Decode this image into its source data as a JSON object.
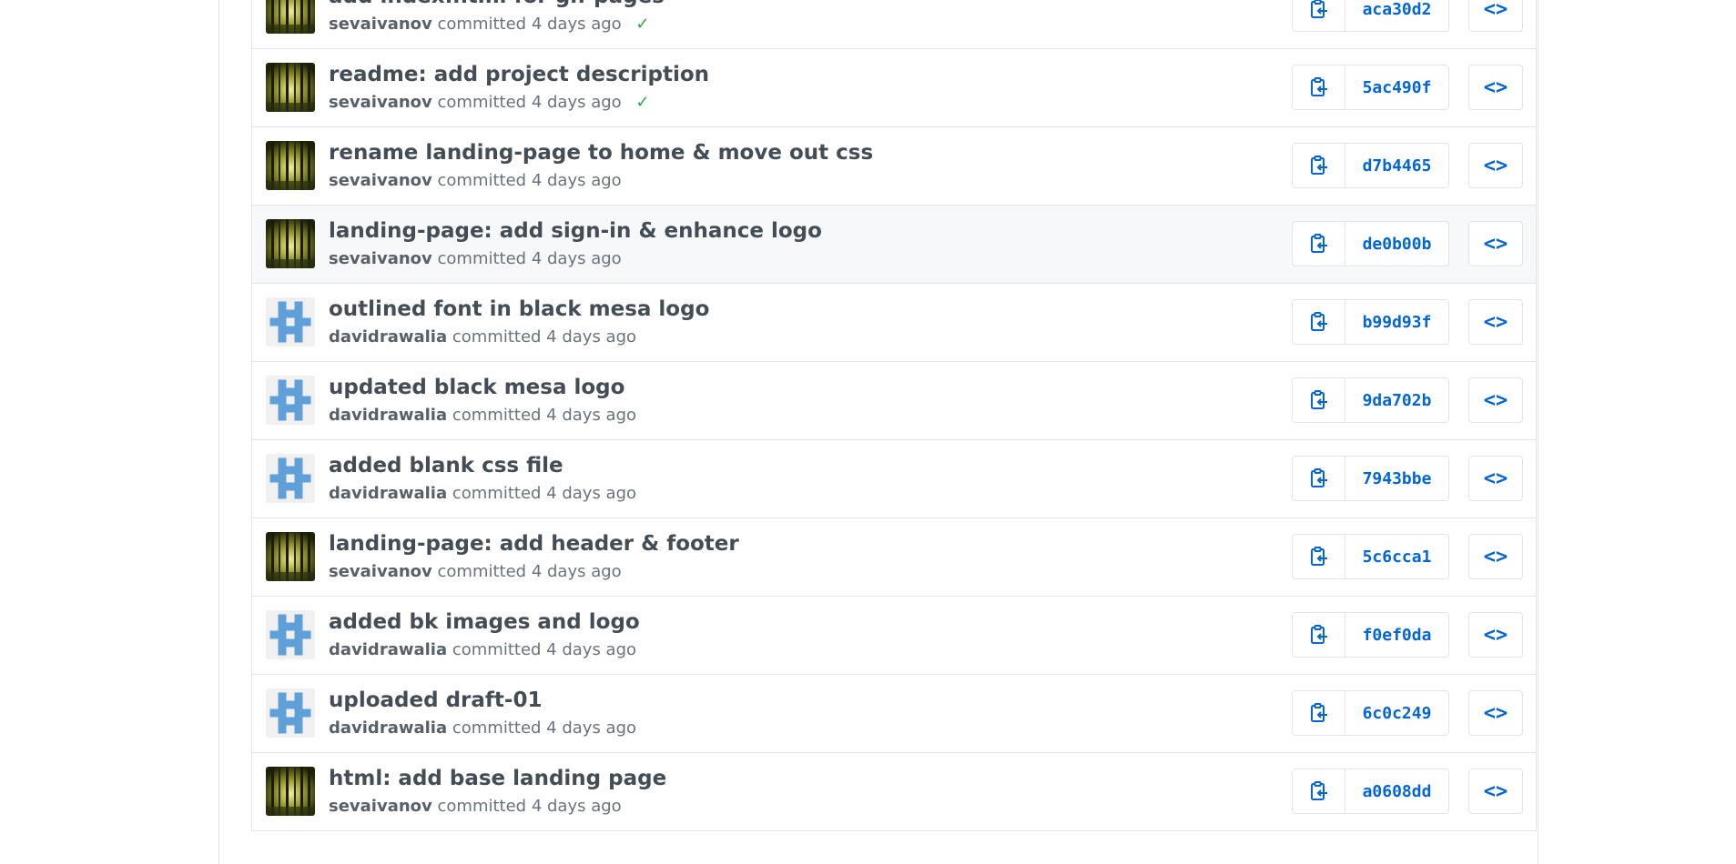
{
  "commits": [
    {
      "message": "add index.html for gh-pages",
      "author": "sevaivanov",
      "action": "committed",
      "time": "4 days ago",
      "verified": true,
      "sha": "aca30d2",
      "avatar": "forest"
    },
    {
      "message": "readme: add project description",
      "author": "sevaivanov",
      "action": "committed",
      "time": "4 days ago",
      "verified": true,
      "sha": "5ac490f",
      "avatar": "forest"
    },
    {
      "message": "rename landing-page to home & move out css",
      "author": "sevaivanov",
      "action": "committed",
      "time": "4 days ago",
      "verified": false,
      "sha": "d7b4465",
      "avatar": "forest"
    },
    {
      "message": "landing-page: add sign-in & enhance logo",
      "author": "sevaivanov",
      "action": "committed",
      "time": "4 days ago",
      "verified": false,
      "sha": "de0b00b",
      "avatar": "forest"
    },
    {
      "message": "outlined font in black mesa logo",
      "author": "davidrawalia",
      "action": "committed",
      "time": "4 days ago",
      "verified": false,
      "sha": "b99d93f",
      "avatar": "identicon"
    },
    {
      "message": "updated black mesa logo",
      "author": "davidrawalia",
      "action": "committed",
      "time": "4 days ago",
      "verified": false,
      "sha": "9da702b",
      "avatar": "identicon"
    },
    {
      "message": "added blank css file",
      "author": "davidrawalia",
      "action": "committed",
      "time": "4 days ago",
      "verified": false,
      "sha": "7943bbe",
      "avatar": "identicon"
    },
    {
      "message": "landing-page: add header & footer",
      "author": "sevaivanov",
      "action": "committed",
      "time": "4 days ago",
      "verified": false,
      "sha": "5c6cca1",
      "avatar": "forest"
    },
    {
      "message": "added bk images and logo",
      "author": "davidrawalia",
      "action": "committed",
      "time": "4 days ago",
      "verified": false,
      "sha": "f0ef0da",
      "avatar": "identicon"
    },
    {
      "message": "uploaded draft-01",
      "author": "davidrawalia",
      "action": "committed",
      "time": "4 days ago",
      "verified": false,
      "sha": "6c0c249",
      "avatar": "identicon"
    },
    {
      "message": "html: add base landing page",
      "author": "sevaivanov",
      "action": "committed",
      "time": "4 days ago",
      "verified": false,
      "sha": "a0608dd",
      "avatar": "forest"
    }
  ],
  "highlighted_index": 3,
  "icons": {
    "copy": "clipboard-icon",
    "browse": "code-icon",
    "verified": "check-icon"
  },
  "colors": {
    "link": "#0366d6",
    "check": "#28a745",
    "identicon": "#5fa0d8",
    "row_highlight": "#f6f8fa"
  }
}
